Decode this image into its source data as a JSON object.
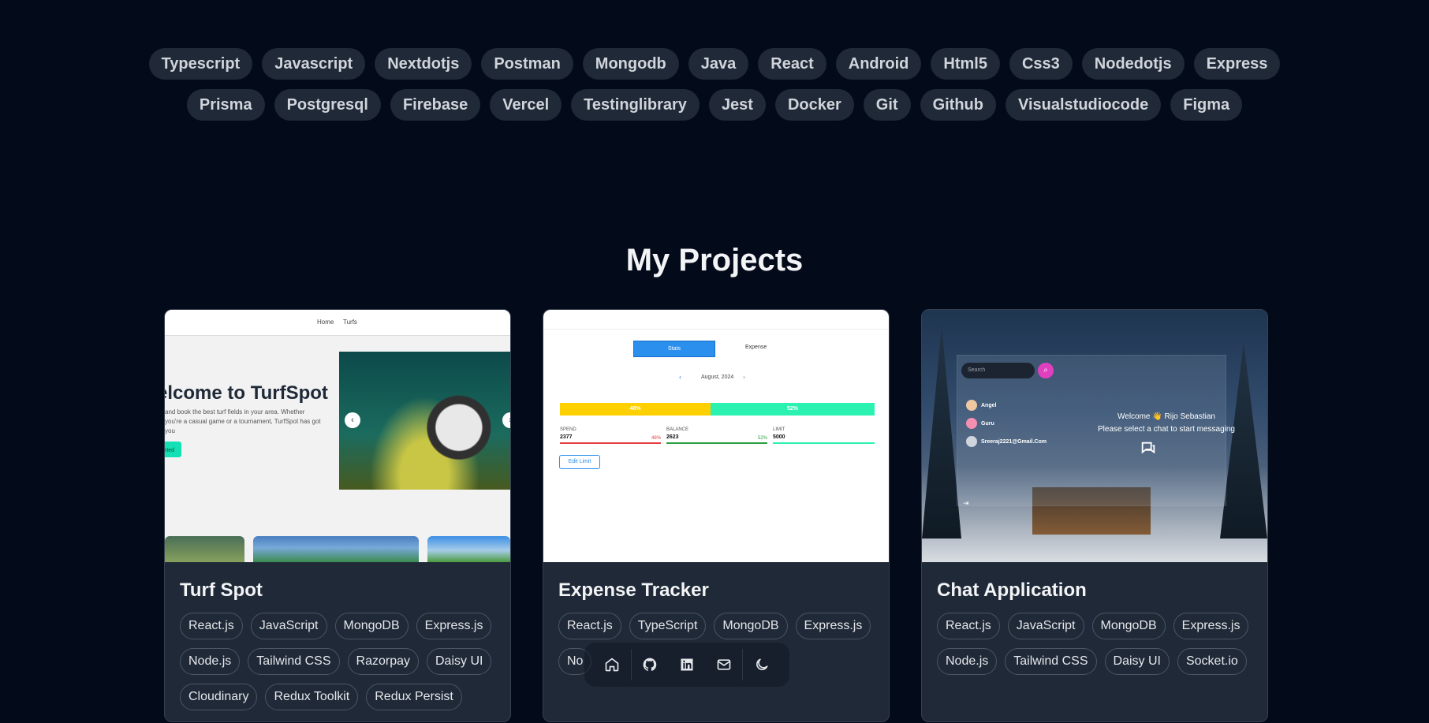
{
  "skills": {
    "row1": [
      "Typescript",
      "Javascript",
      "Nextdotjs",
      "Postman",
      "Mongodb",
      "Java",
      "React",
      "Android",
      "Html5",
      "Css3",
      "Nodedotjs",
      "Express"
    ],
    "row2": [
      "Prisma",
      "Postgresql",
      "Firebase",
      "Vercel",
      "Testinglibrary",
      "Jest",
      "Docker",
      "Git",
      "Github",
      "Visualstudiocode",
      "Figma"
    ]
  },
  "projects_title": "My Projects",
  "projects": [
    {
      "title": "Turf Spot",
      "tags": [
        "React.js",
        "JavaScript",
        "MongoDB",
        "Express.js",
        "Node.js",
        "Tailwind CSS",
        "Razorpay",
        "Daisy UI",
        "Cloudinary",
        "Redux Toolkit",
        "Redux Persist"
      ],
      "preview": {
        "nav": [
          "Home",
          "Turfs"
        ],
        "hero_title": "elcome to TurfSpot",
        "hero_desc": "and book the best turf fields in your area. Whether you're a casual game or a tournament, TurfSpot has got you",
        "hero_button": "rted"
      }
    },
    {
      "title": "Expense Tracker",
      "tags": [
        "React.js",
        "TypeScript",
        "MongoDB",
        "Express.js",
        "No"
      ],
      "preview": {
        "stats_tab": "Stats",
        "expense_tab": "Expense",
        "month": "August, 2024",
        "bar_left": "48%",
        "bar_right": "52%",
        "spend_label": "SPEND",
        "spend_value": "2377",
        "spend_pct": "48%",
        "balance_label": "BALANCE",
        "balance_value": "2623",
        "balance_pct": "52%",
        "limit_label": "LIMIT",
        "limit_value": "5000",
        "edit_button": "Edit Limit"
      }
    },
    {
      "title": "Chat Application",
      "tags": [
        "React.js",
        "JavaScript",
        "MongoDB",
        "Express.js",
        "Node.js",
        "Tailwind CSS",
        "Daisy UI",
        "Socket.io"
      ],
      "preview": {
        "search_placeholder": "Search",
        "contacts": [
          "Angel",
          "Guru",
          "Sreeraj2221@Gmail.Com"
        ],
        "welcome_line1": "Welcome 👋 Rijo Sebastian",
        "welcome_line2": "Please select a chat to start messaging"
      }
    }
  ],
  "dock": [
    "home-icon",
    "github-icon",
    "linkedin-icon",
    "mail-icon",
    "moon-icon"
  ],
  "colors": {
    "background": "#030a1a",
    "card": "#1f2937",
    "pill": "#1f2937",
    "accent_blue": "#2b8fee",
    "accent_teal": "#2bf2b0",
    "accent_yellow": "#ffd000"
  }
}
